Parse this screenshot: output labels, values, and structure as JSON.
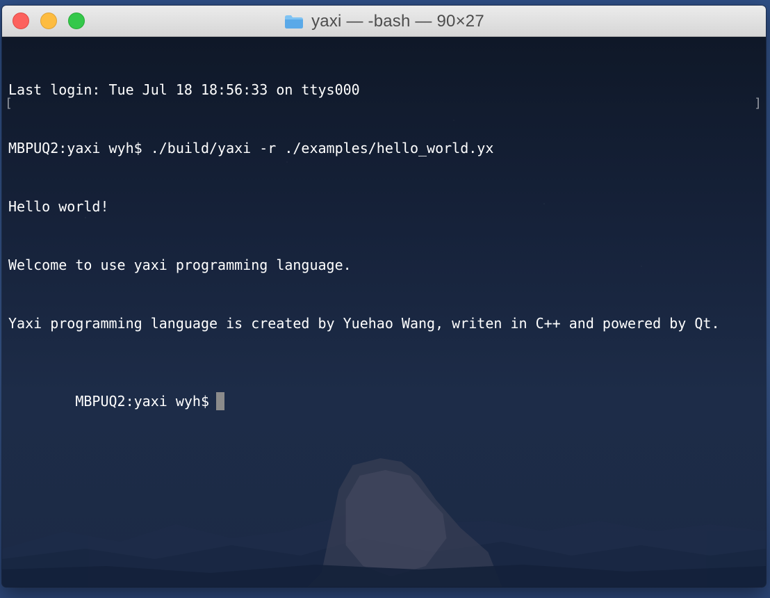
{
  "window": {
    "title": "yaxi — -bash — 90×27"
  },
  "terminal": {
    "lines": [
      "Last login: Tue Jul 18 18:56:33 on ttys000",
      "MBPUQ2:yaxi wyh$ ./build/yaxi -r ./examples/hello_world.yx",
      "Hello world!",
      "Welcome to use yaxi programming language.",
      "Yaxi programming language is created by Yuehao Wang, writen in C++ and powered by Qt.",
      "MBPUQ2:yaxi wyh$"
    ],
    "marker_left": "[",
    "marker_right": "]"
  },
  "colors": {
    "close": "#fc615d",
    "minimize": "#fdbc40",
    "zoom": "#34c84a",
    "terminal_text": "#ffffff",
    "cursor": "#8b8b8b"
  },
  "icons": {
    "folder": "folder-icon"
  }
}
